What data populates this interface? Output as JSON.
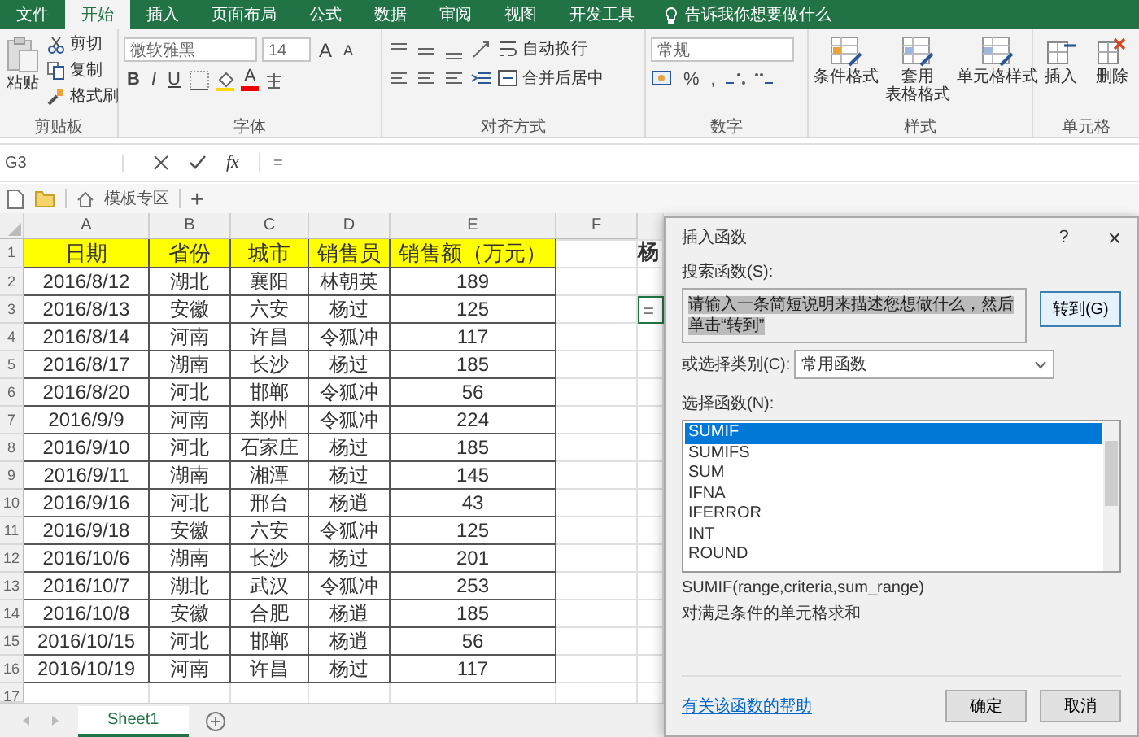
{
  "menu": {
    "tabs": [
      {
        "label": "文件",
        "selected": false
      },
      {
        "label": "开始",
        "selected": true
      },
      {
        "label": "插入",
        "selected": false
      },
      {
        "label": "页面布局",
        "selected": false
      },
      {
        "label": "公式",
        "selected": false
      },
      {
        "label": "数据",
        "selected": false
      },
      {
        "label": "审阅",
        "selected": false
      },
      {
        "label": "视图",
        "selected": false
      },
      {
        "label": "开发工具",
        "selected": false
      }
    ],
    "tell_me": "告诉我你想要做什么"
  },
  "ribbon": {
    "clipboard": {
      "paste": "粘贴",
      "cut": "剪切",
      "copy": "复制",
      "painter": "格式刷",
      "label": "剪贴板"
    },
    "font": {
      "name": "微软雅黑",
      "size": "14",
      "grow": "A",
      "shrink": "A",
      "bold": "B",
      "italic": "I",
      "underline": "U",
      "color_letter": "A",
      "label": "字体"
    },
    "alignment": {
      "wrap": "自动换行",
      "merge": "合并后居中",
      "label": "对齐方式"
    },
    "number": {
      "format": "常规",
      "percent": "%",
      "comma": ",",
      "label": "数字"
    },
    "styles": {
      "items": [
        {
          "lines": [
            "条件格式"
          ]
        },
        {
          "lines": [
            "套用",
            "表格格式"
          ]
        },
        {
          "lines": [
            "单元格样式"
          ]
        }
      ],
      "label": "样式"
    },
    "cells": {
      "items": [
        "插入",
        "删除"
      ],
      "label": "单元格"
    }
  },
  "formula_bar": {
    "name_box": "G3",
    "fx": "fx",
    "formula": "="
  },
  "quick_bar": {
    "template": "模板专区",
    "add": "+"
  },
  "sheet": {
    "columns": [
      "A",
      "B",
      "C",
      "D",
      "E",
      "F"
    ],
    "rows": [
      {
        "num": "1",
        "kind": "header",
        "cells": [
          "日期",
          "省份",
          "城市",
          "销售员",
          "销售额（万元）"
        ],
        "g": {
          "text": "杨",
          "kind": "title"
        }
      },
      {
        "num": "2",
        "kind": "data",
        "cells": [
          "2016/8/12",
          "湖北",
          "襄阳",
          "林朝英",
          "189"
        ]
      },
      {
        "num": "3",
        "kind": "data",
        "cells": [
          "2016/8/13",
          "安徽",
          "六安",
          "杨过",
          "125"
        ],
        "g": {
          "text": "=",
          "kind": "active"
        }
      },
      {
        "num": "4",
        "kind": "data",
        "cells": [
          "2016/8/14",
          "河南",
          "许昌",
          "令狐冲",
          "117"
        ]
      },
      {
        "num": "5",
        "kind": "data",
        "cells": [
          "2016/8/17",
          "湖南",
          "长沙",
          "杨过",
          "185"
        ]
      },
      {
        "num": "6",
        "kind": "data",
        "cells": [
          "2016/8/20",
          "河北",
          "邯郸",
          "令狐冲",
          "56"
        ]
      },
      {
        "num": "7",
        "kind": "data",
        "cells": [
          "2016/9/9",
          "河南",
          "郑州",
          "令狐冲",
          "224"
        ]
      },
      {
        "num": "8",
        "kind": "data",
        "cells": [
          "2016/9/10",
          "河北",
          "石家庄",
          "杨过",
          "185"
        ]
      },
      {
        "num": "9",
        "kind": "data",
        "cells": [
          "2016/9/11",
          "湖南",
          "湘潭",
          "杨过",
          "145"
        ]
      },
      {
        "num": "10",
        "kind": "data",
        "cells": [
          "2016/9/16",
          "河北",
          "邢台",
          "杨逍",
          "43"
        ]
      },
      {
        "num": "11",
        "kind": "data",
        "cells": [
          "2016/9/18",
          "安徽",
          "六安",
          "令狐冲",
          "125"
        ]
      },
      {
        "num": "12",
        "kind": "data",
        "cells": [
          "2016/10/6",
          "湖南",
          "长沙",
          "杨过",
          "201"
        ]
      },
      {
        "num": "13",
        "kind": "data",
        "cells": [
          "2016/10/7",
          "湖北",
          "武汉",
          "令狐冲",
          "253"
        ]
      },
      {
        "num": "14",
        "kind": "data",
        "cells": [
          "2016/10/8",
          "安徽",
          "合肥",
          "杨逍",
          "185"
        ]
      },
      {
        "num": "15",
        "kind": "data",
        "cells": [
          "2016/10/15",
          "河北",
          "邯郸",
          "杨逍",
          "56"
        ]
      },
      {
        "num": "16",
        "kind": "data",
        "cells": [
          "2016/10/19",
          "河南",
          "许昌",
          "杨过",
          "117"
        ]
      },
      {
        "num": "17",
        "kind": "empty"
      }
    ]
  },
  "sheet_tabs": [
    {
      "label": "Sheet1",
      "selected": true
    }
  ],
  "dialog": {
    "title": "插入函数",
    "help": "?",
    "close": "×",
    "search_label": "搜索函数(S):",
    "search_value": "请输入一条简短说明来描述您想做什么，然后单击“转到”",
    "go": "转到(G)",
    "category_label": "或选择类别(C):",
    "category": "常用函数",
    "list_label": "选择函数(N):",
    "functions": [
      {
        "name": "SUMIF",
        "selected": true
      },
      {
        "name": "SUMIFS",
        "selected": false
      },
      {
        "name": "SUM",
        "selected": false
      },
      {
        "name": "IFNA",
        "selected": false
      },
      {
        "name": "IFERROR",
        "selected": false
      },
      {
        "name": "INT",
        "selected": false
      },
      {
        "name": "ROUND",
        "selected": false
      }
    ],
    "syntax": "SUMIF(range,criteria,sum_range)",
    "description": "对满足条件的单元格求和",
    "help_link": "有关该函数的帮助",
    "ok": "确定",
    "cancel": "取消"
  }
}
